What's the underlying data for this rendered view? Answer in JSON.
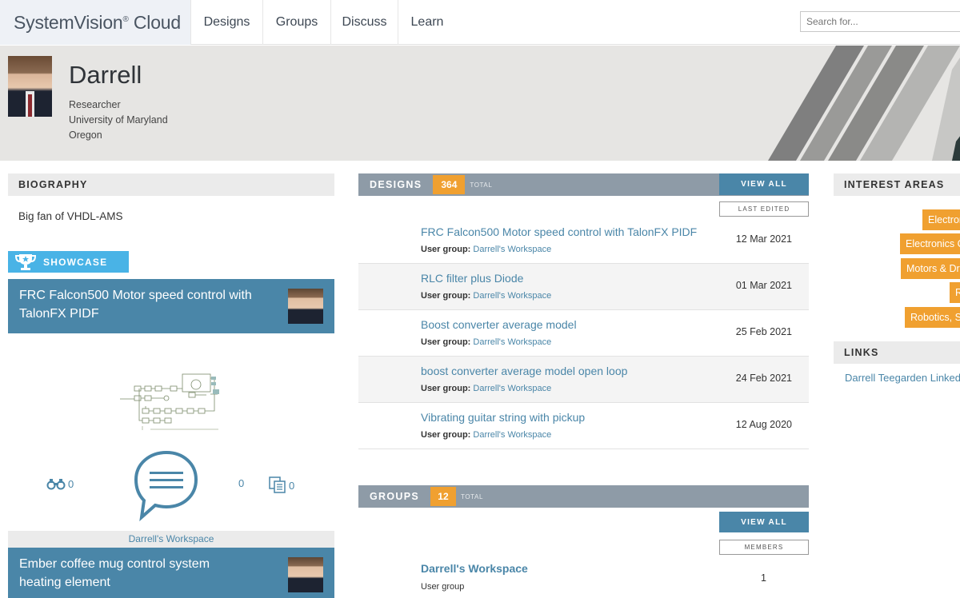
{
  "nav": {
    "logo": "SystemVision",
    "logo_mark": "®",
    "logo_suffix": " Cloud",
    "items": [
      "Designs",
      "Groups",
      "Discuss",
      "Learn"
    ],
    "search_placeholder": "Search for..."
  },
  "profile": {
    "name": "Darrell",
    "title": "Researcher",
    "organization": "University of Maryland",
    "location": "Oregon"
  },
  "biography": {
    "heading": "BIOGRAPHY",
    "text": "Big fan of VHDL-AMS"
  },
  "showcase": {
    "label": "SHOWCASE",
    "item1_title": "FRC Falcon500 Motor speed control with TalonFX PIDF",
    "item1_views": "0",
    "item1_comments": "0",
    "item1_copies": "0",
    "workspace": "Darrell's Workspace",
    "item2_title": "Ember coffee mug control system heating element"
  },
  "designs": {
    "heading": "DESIGNS",
    "count": "364",
    "total_label": "TOTAL",
    "view_all": "VIEW ALL",
    "sort_label": "LAST EDITED",
    "user_group_label": "User group:",
    "rows": [
      {
        "title": "FRC Falcon500 Motor speed control with TalonFX PIDF",
        "group": "Darrell's Workspace",
        "date": "12 Mar 2021"
      },
      {
        "title": "RLC filter plus Diode",
        "group": "Darrell's Workspace",
        "date": "01 Mar 2021"
      },
      {
        "title": "Boost converter average model",
        "group": "Darrell's Workspace",
        "date": "25 Feb 2021"
      },
      {
        "title": "boost converter average model open loop",
        "group": "Darrell's Workspace",
        "date": "24 Feb 2021"
      },
      {
        "title": "Vibrating guitar string with pickup",
        "group": "Darrell's Workspace",
        "date": "12 Aug 2020"
      }
    ]
  },
  "groups": {
    "heading": "GROUPS",
    "count": "12",
    "total_label": "TOTAL",
    "view_all": "VIEW ALL",
    "sort_label": "MEMBERS",
    "rows": [
      {
        "title": "Darrell's Workspace",
        "subtitle": "User group",
        "members": "1"
      }
    ]
  },
  "interests": {
    "heading": "INTEREST AREAS",
    "tags": [
      "Electronics",
      "Electronics Circuits",
      "Motors & Drives",
      "Robotics",
      "Robotics, Systems"
    ]
  },
  "links": {
    "heading": "LINKS",
    "items": [
      "Darrell Teegarden LinkedIn"
    ]
  },
  "colors": {
    "accent_blue": "#4a86a8",
    "orange": "#f0a030",
    "header_gray": "#8e9ba7"
  }
}
